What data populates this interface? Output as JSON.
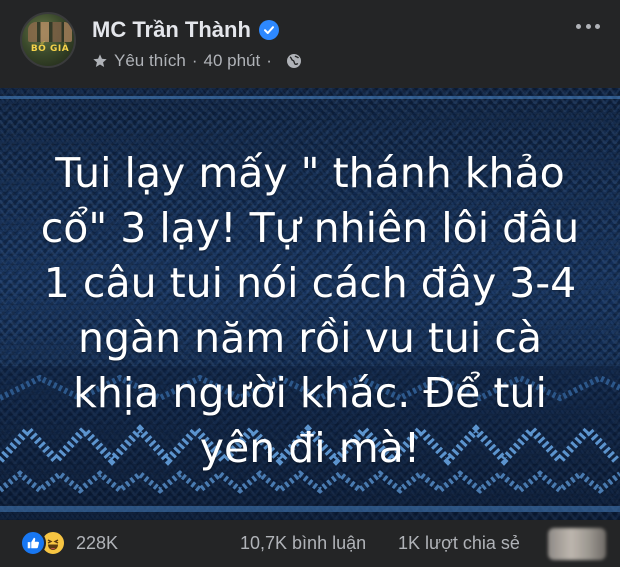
{
  "post": {
    "author": "MC Trần Thành",
    "audience": "Yêu thích",
    "separator": "·",
    "time": "40 phút",
    "avatar_text": "BỐ GIÀ",
    "icons": {
      "verified": "verified-badge-icon",
      "star": "star-icon",
      "globe": "globe-icon",
      "more": "more-options-icon"
    }
  },
  "image": {
    "caption_lines": [
      "Tui lạy mấy \" thánh khảo",
      "cổ\" 3 lạy! Tự nhiên lôi đâu",
      "1 câu tui nói cách đây 3-4",
      "ngàn năm rồi vu tui cà",
      "khịa người khác. Để tui",
      "yên đi mà!"
    ],
    "background": "knitted-sweater-blue"
  },
  "footer": {
    "reaction_count": "228K",
    "comments": "10,7K bình luận",
    "shares": "1K lượt chia sẻ",
    "icons": {
      "like": "like-reaction-icon",
      "haha": "haha-reaction-icon"
    }
  },
  "colors": {
    "background": "#242526",
    "primary_text": "#e4e6eb",
    "secondary_text": "#b0b3b8",
    "verified_blue": "#2d88ff",
    "like_blue": "#1877f2",
    "haha_yellow": "#f7c542"
  }
}
